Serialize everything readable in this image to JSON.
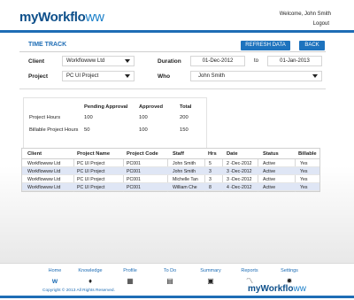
{
  "header": {
    "logo_text": "myWorkflo",
    "logo_wave": "ww",
    "welcome": "Welcome, John Smith",
    "logout": "Logout"
  },
  "toolbar": {
    "title": "TIME TRACK",
    "refresh_label": "REFRESH DATA",
    "back_label": "BACK"
  },
  "filters": {
    "client_label": "Client",
    "client_value": "Workflowww Ltd",
    "project_label": "Project",
    "project_value": "PC UI Project",
    "duration_label": "Duration",
    "duration_from": "01-Dec-2012",
    "duration_to_label": "to",
    "duration_to": "01-Jan-2013",
    "who_label": "Who",
    "who_value": "John Smith"
  },
  "summary": {
    "headers": [
      "Pending Approval",
      "Approved",
      "Total"
    ],
    "rows": [
      {
        "label": "Project Hours",
        "values": [
          "100",
          "100",
          "200"
        ]
      },
      {
        "label": "Billable Project Hours",
        "values": [
          "50",
          "100",
          "150"
        ]
      }
    ]
  },
  "grid": {
    "headers": [
      "Client",
      "Project Name",
      "Project Code",
      "Staff",
      "Hrs",
      "Date",
      "Status",
      "Billable"
    ],
    "rows": [
      [
        "Workflowww Ltd",
        "PC UI Project",
        "PC001",
        "John Smith",
        "5",
        "2 -Dec-2012",
        "Active",
        "Yes"
      ],
      [
        "Workflowww Ltd",
        "PC UI Project",
        "PC001",
        "John Smith",
        "3",
        "3 -Dec-2012",
        "Active",
        "Yes"
      ],
      [
        "Workflowww Ltd",
        "PC UI Project",
        "PC001",
        "Michelle Tan",
        "3",
        "3 -Dec-2012",
        "Active",
        "Yes"
      ],
      [
        "Workflowww Ltd",
        "PC UI Project",
        "PC001",
        "William Che",
        "8",
        "4 -Dec-2012",
        "Active",
        "Yes"
      ]
    ]
  },
  "footer": {
    "nav": [
      {
        "label": "Home",
        "icon": "w"
      },
      {
        "label": "Knowledge",
        "icon": "♦"
      },
      {
        "label": "Profile",
        "icon": "▦"
      },
      {
        "label": "To Do",
        "icon": "▤"
      },
      {
        "label": "Summary",
        "icon": "▣"
      },
      {
        "label": "Reports",
        "icon": "〽"
      },
      {
        "label": "Settings",
        "icon": "✹"
      }
    ],
    "copyright": "Copyright © 2013 All Rights Reserved.",
    "logo_text": "myWorkflo",
    "logo_wave": "ww"
  },
  "colors": {
    "brand_blue": "#1e6db5",
    "row_highlight": "#dfe6f5"
  }
}
